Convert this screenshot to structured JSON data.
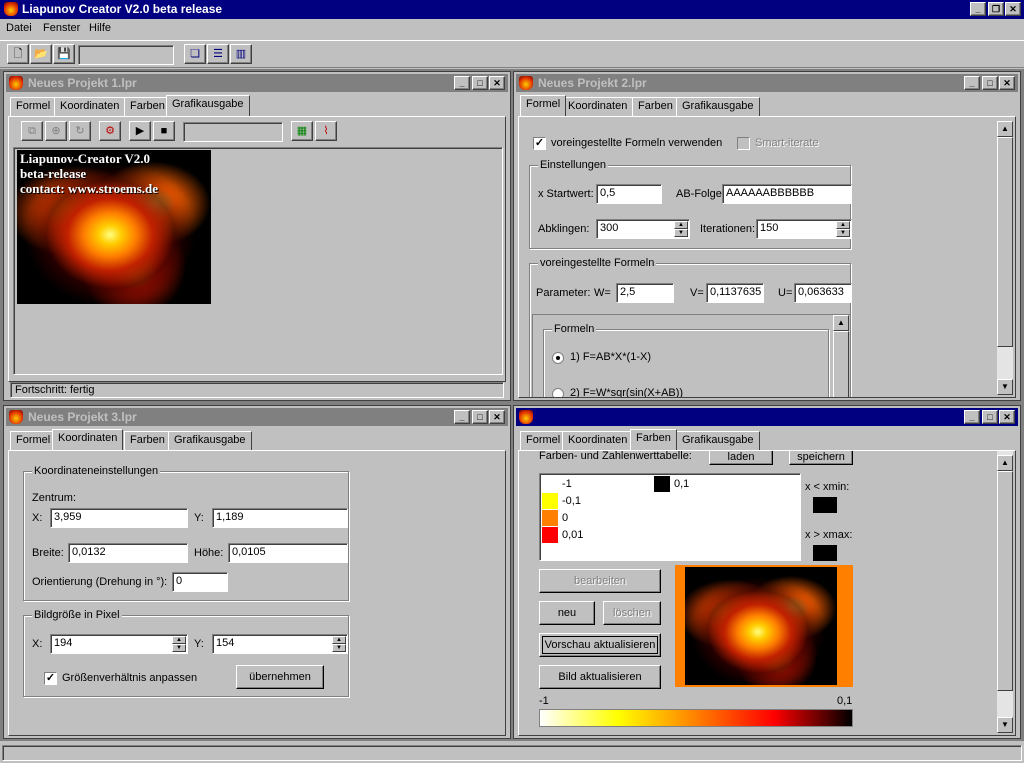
{
  "app": {
    "title": "Liapunov Creator V2.0 beta release",
    "menu": [
      "Datei",
      "Fenster",
      "Hilfe"
    ],
    "accent": "#000080"
  },
  "win1": {
    "title": "Neues Projekt 1.lpr",
    "tabs": [
      "Formel",
      "Koordinaten",
      "Farben",
      "Grafikausgabe"
    ],
    "preview_text": [
      "Liapunov-Creator V2.0",
      "beta-release",
      "contact: www.stroems.de"
    ],
    "status": "Fortschritt: fertig"
  },
  "win2": {
    "title": "Neues Projekt 2.lpr",
    "tabs": [
      "Formel",
      "Koordinaten",
      "Farben",
      "Grafikausgabe"
    ],
    "use_preset": "voreingestellte Formeln verwenden",
    "smart_iterate": "Smart-iterate",
    "settings_group": "Einstellungen",
    "x_start_label": "x Startwert:",
    "x_start": "0,5",
    "ab_label": "AB-Folge:",
    "ab_value": "AAAAAABBBBBB",
    "decay_label": "Abklingen:",
    "decay": "300",
    "iter_label": "Iterationen:",
    "iter": "150",
    "preset_group": "voreingestellte Formeln",
    "param_label": "Parameter:",
    "w_label": "W=",
    "w_value": "2,5",
    "v_label": "V=",
    "v_value": "0,1137635",
    "u_label": "U=",
    "u_value": "0,063633",
    "formulas_group": "Formeln",
    "formula1": "1) F=AB*X*(1-X)",
    "formula2": "2) F=W*sqr(sin(X+AB))"
  },
  "win3": {
    "title": "Neues Projekt 3.lpr",
    "tabs": [
      "Formel",
      "Koordinaten",
      "Farben",
      "Grafikausgabe"
    ],
    "coord_group": "Koordinateneinstellungen",
    "center_label": "Zentrum:",
    "x_label": "X:",
    "x_value": "3,959",
    "y_label": "Y:",
    "y_value": "1,189",
    "width_label": "Breite:",
    "width_value": "0,0132",
    "height_label": "Höhe:",
    "height_value": "0,0105",
    "orient_label": "Orientierung (Drehung in °):",
    "orient_value": "0",
    "size_group": "Bildgröße in Pixel",
    "px_x_label": "X:",
    "px_x": "194",
    "px_y_label": "Y:",
    "px_y": "154",
    "aspect_label": "Größenverhältnis anpassen",
    "apply_btn": "übernehmen"
  },
  "win4": {
    "tabs": [
      "Formel",
      "Koordinaten",
      "Farben",
      "Grafikausgabe"
    ],
    "table_label": "Farben- und Zahlenwerttabelle:",
    "load_btn": "laden",
    "save_btn": "speichern",
    "color_entries": [
      {
        "value": "-1",
        "color": "#ffffff"
      },
      {
        "value": "-0,1",
        "color": "#ffff00"
      },
      {
        "value": "0",
        "color": "#ff8000"
      },
      {
        "value": "0,01",
        "color": "#ff0000"
      }
    ],
    "right_entry": {
      "value": "0,1",
      "color": "#000000"
    },
    "xmin_label": "x < xmin:",
    "xmax_label": "x > xmax:",
    "edit_btn": "bearbeiten",
    "new_btn": "neu",
    "delete_btn": "löschen",
    "preview_btn": "Vorschau aktualisieren",
    "image_btn": "Bild aktualisieren",
    "scale_min": "-1",
    "scale_max": "0,1"
  }
}
